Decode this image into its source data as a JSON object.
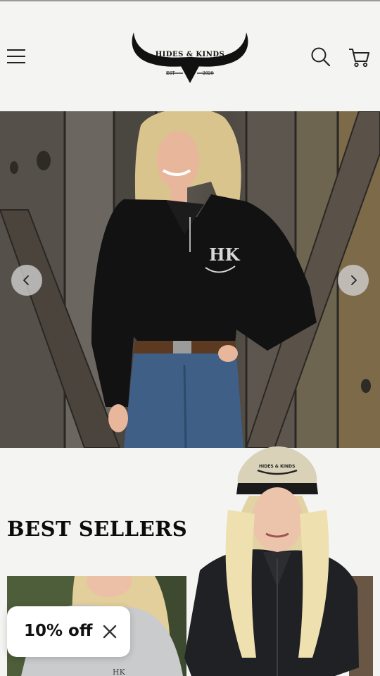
{
  "header": {
    "brand_name": "HIDES & KINDS",
    "brand_est": "EST",
    "brand_year": "2020",
    "menu_icon": "hamburger-menu-icon",
    "search_icon": "search-icon",
    "cart_icon": "cart-icon"
  },
  "hero": {
    "slide_prev_icon": "chevron-left-icon",
    "slide_next_icon": "chevron-right-icon",
    "shirt_logo": "HK"
  },
  "best_sellers": {
    "title": "BEST SELLERS"
  },
  "overlay_cap": {
    "brand_text": "HIDES & KINDS"
  },
  "discount": {
    "label": "10% off",
    "close_icon": "close-icon"
  },
  "colors": {
    "background": "#f4f4f2",
    "text": "#0c0c0c",
    "pill": "#ffffff"
  }
}
